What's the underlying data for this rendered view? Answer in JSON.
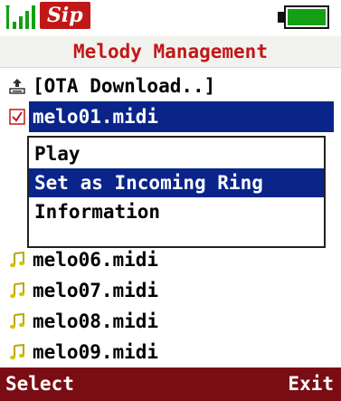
{
  "status_bar": {
    "logo_text": "Sip",
    "battery_level": 1.0,
    "battery_color": "#14a014"
  },
  "title": "Melody Management",
  "list": {
    "items": [
      {
        "label": "[OTA Download..]",
        "icon": "download-icon"
      },
      {
        "label": "melo01.midi",
        "icon": "checkbox-checked-icon",
        "selected": true
      },
      {
        "label": "melo06.midi",
        "icon": "music-note-icon"
      },
      {
        "label": "melo07.midi",
        "icon": "music-note-icon"
      },
      {
        "label": "melo08.midi",
        "icon": "music-note-icon"
      },
      {
        "label": "melo09.midi",
        "icon": "music-note-icon"
      }
    ]
  },
  "popup": {
    "items": [
      {
        "label": "Play"
      },
      {
        "label": "Set as Incoming Ring",
        "selected": true
      },
      {
        "label": "Information"
      }
    ]
  },
  "softkeys": {
    "left": "Select",
    "right": "Exit"
  },
  "colors": {
    "title_text": "#c01818",
    "selection": "#0a248a",
    "softkey_bar": "#7a0d14"
  }
}
